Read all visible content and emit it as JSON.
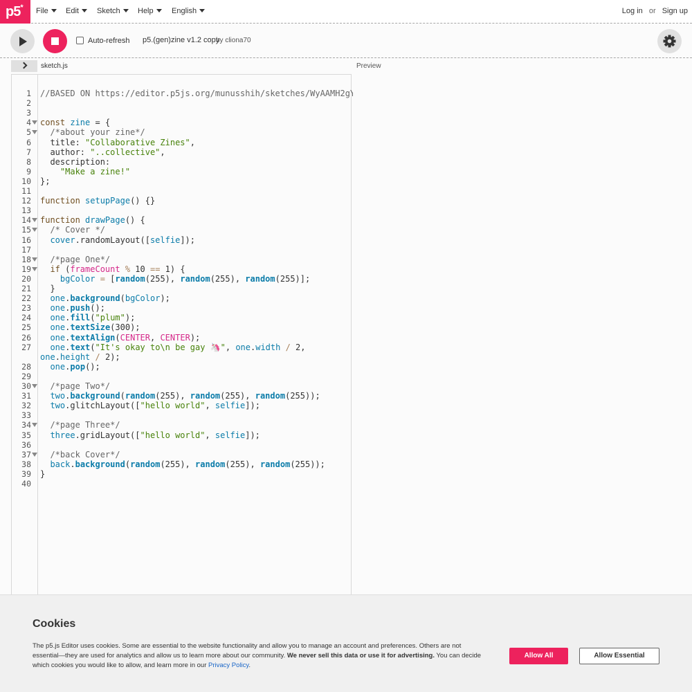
{
  "nav": {
    "logo": "p5",
    "logo_star": "*",
    "menus": [
      "File",
      "Edit",
      "Sketch",
      "Help",
      "English"
    ],
    "login": "Log in",
    "or": "or",
    "signup": "Sign up"
  },
  "toolbar": {
    "autorefresh_label": "Auto-refresh",
    "autorefresh_checked": false,
    "sketch_name": "p5.(gen)zine v1.2 copy",
    "owner": "by cliona70"
  },
  "editor": {
    "file_name": "sketch.js",
    "preview_label": "Preview",
    "line_count": 40,
    "fold_lines": [
      4,
      5,
      14,
      15,
      18,
      19,
      30,
      34,
      37
    ]
  },
  "cookies": {
    "title": "Cookies",
    "text1": "The p5.js Editor uses cookies. Some are essential to the website functionality and allow you to manage an account and preferences. Others are not essential—they are used for analytics and allow us to learn more about our community. ",
    "text_bold": "We never sell this data or use it for advertising.",
    "text2": " You can decide which cookies you would like to allow, and learn more in our ",
    "privacy_link": "Privacy Policy",
    "text_end": ".",
    "allow_all": "Allow All",
    "allow_essential": "Allow Essential"
  },
  "colors": {
    "brand": "#ed225d",
    "link": "#1a66c7"
  }
}
